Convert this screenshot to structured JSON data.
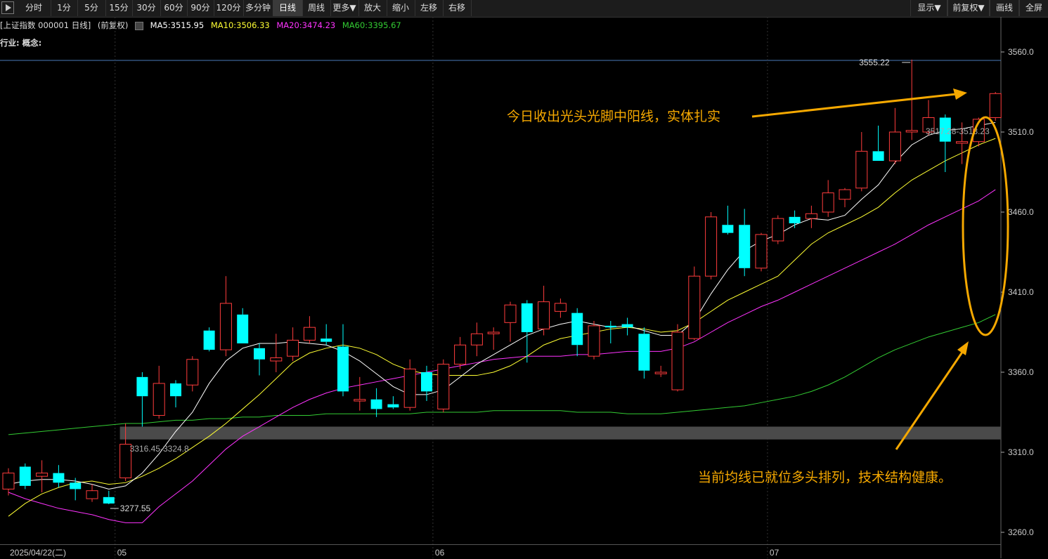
{
  "toolbar": {
    "items": [
      {
        "label": "分时"
      },
      {
        "label": "1分"
      },
      {
        "label": "5分"
      },
      {
        "label": "15分"
      },
      {
        "label": "30分"
      },
      {
        "label": "60分"
      },
      {
        "label": "90分"
      },
      {
        "label": "120分"
      },
      {
        "label": "多分钟"
      },
      {
        "label": "日线",
        "active": true
      },
      {
        "label": "周线"
      },
      {
        "label": "更多▼"
      },
      {
        "label": "放大"
      },
      {
        "label": "缩小"
      },
      {
        "label": "左移"
      },
      {
        "label": "右移"
      }
    ],
    "right_items": [
      {
        "label": "显示▼"
      },
      {
        "label": "前复权▼"
      },
      {
        "label": "画线"
      },
      {
        "label": "全屏"
      }
    ]
  },
  "info": {
    "title": "[上证指数 000001 日线]",
    "adjust": "(前复权)",
    "ma5": "MA5:3515.95",
    "ma10": "MA10:3506.33",
    "ma20": "MA20:3474.23",
    "ma60": "MA60:3395.67",
    "industry": "行业: 概念:"
  },
  "colors": {
    "up": "#ff3c3c",
    "down": "#00ffff",
    "ma5": "#ffffff",
    "ma10": "#ffff33",
    "ma20": "#ff33ff",
    "ma60": "#33cc33",
    "annotation": "#f5a800",
    "axis": "#cccccc"
  },
  "chart_data": {
    "type": "candlestick",
    "ylim": [
      3250,
      3570
    ],
    "y_ticks": [
      "3560.0",
      "3510.0",
      "3460.0",
      "3410.0",
      "3360.0",
      "3310.0",
      "3260.0"
    ],
    "x_labels": [
      {
        "label": "2025/04/22(二)",
        "index": 0
      },
      {
        "label": "05",
        "index": 7
      },
      {
        "label": "06",
        "index": 26
      },
      {
        "label": "07",
        "index": 46
      }
    ],
    "candles": [
      {
        "o": 3287,
        "h": 3300,
        "l": 3283,
        "c": 3297
      },
      {
        "o": 3301,
        "h": 3303,
        "l": 3287,
        "c": 3289
      },
      {
        "o": 3295,
        "h": 3305,
        "l": 3285,
        "c": 3297
      },
      {
        "o": 3297,
        "h": 3302,
        "l": 3288,
        "c": 3291
      },
      {
        "o": 3291,
        "h": 3294,
        "l": 3280,
        "c": 3287
      },
      {
        "o": 3281,
        "h": 3290,
        "l": 3279,
        "c": 3286
      },
      {
        "o": 3282,
        "h": 3286,
        "l": 3277.55,
        "c": 3278
      },
      {
        "o": 3294,
        "h": 3328,
        "l": 3292,
        "c": 3315
      },
      {
        "o": 3357,
        "h": 3360,
        "l": 3326,
        "c": 3345
      },
      {
        "o": 3333,
        "h": 3364,
        "l": 3331,
        "c": 3353
      },
      {
        "o": 3353,
        "h": 3355,
        "l": 3338,
        "c": 3345
      },
      {
        "o": 3352,
        "h": 3370,
        "l": 3348,
        "c": 3368
      },
      {
        "o": 3386,
        "h": 3388,
        "l": 3373,
        "c": 3374
      },
      {
        "o": 3374,
        "h": 3420,
        "l": 3370,
        "c": 3403
      },
      {
        "o": 3396,
        "h": 3400,
        "l": 3378,
        "c": 3378
      },
      {
        "o": 3375,
        "h": 3378,
        "l": 3358,
        "c": 3368
      },
      {
        "o": 3367,
        "h": 3384,
        "l": 3360,
        "c": 3369
      },
      {
        "o": 3370,
        "h": 3388,
        "l": 3367,
        "c": 3380
      },
      {
        "o": 3380,
        "h": 3395,
        "l": 3378,
        "c": 3388
      },
      {
        "o": 3381,
        "h": 3390,
        "l": 3377,
        "c": 3379
      },
      {
        "o": 3376,
        "h": 3390,
        "l": 3345,
        "c": 3348
      },
      {
        "o": 3342,
        "h": 3357,
        "l": 3336,
        "c": 3343
      },
      {
        "o": 3343,
        "h": 3350,
        "l": 3332,
        "c": 3337
      },
      {
        "o": 3340,
        "h": 3345,
        "l": 3337,
        "c": 3338
      },
      {
        "o": 3338,
        "h": 3368,
        "l": 3336,
        "c": 3362
      },
      {
        "o": 3360,
        "h": 3364,
        "l": 3342,
        "c": 3348
      },
      {
        "o": 3337,
        "h": 3368,
        "l": 3335,
        "c": 3365
      },
      {
        "o": 3365,
        "h": 3382,
        "l": 3362,
        "c": 3377
      },
      {
        "o": 3377,
        "h": 3391,
        "l": 3370,
        "c": 3384
      },
      {
        "o": 3384,
        "h": 3388,
        "l": 3374,
        "c": 3385
      },
      {
        "o": 3391,
        "h": 3404,
        "l": 3379,
        "c": 3402
      },
      {
        "o": 3403,
        "h": 3405,
        "l": 3366,
        "c": 3385
      },
      {
        "o": 3387,
        "h": 3414,
        "l": 3383,
        "c": 3404
      },
      {
        "o": 3398,
        "h": 3406,
        "l": 3394,
        "c": 3403
      },
      {
        "o": 3397,
        "h": 3400,
        "l": 3370,
        "c": 3377
      },
      {
        "o": 3370,
        "h": 3392,
        "l": 3368,
        "c": 3389
      },
      {
        "o": 3389,
        "h": 3392,
        "l": 3378,
        "c": 3388
      },
      {
        "o": 3390,
        "h": 3394,
        "l": 3383,
        "c": 3388
      },
      {
        "o": 3384,
        "h": 3388,
        "l": 3356,
        "c": 3361
      },
      {
        "o": 3359,
        "h": 3364,
        "l": 3357,
        "c": 3360
      },
      {
        "o": 3349,
        "h": 3390,
        "l": 3348,
        "c": 3385
      },
      {
        "o": 3381,
        "h": 3426,
        "l": 3380,
        "c": 3420
      },
      {
        "o": 3420,
        "h": 3460,
        "l": 3418,
        "c": 3457
      },
      {
        "o": 3452,
        "h": 3464,
        "l": 3446,
        "c": 3447
      },
      {
        "o": 3452,
        "h": 3462,
        "l": 3420,
        "c": 3425
      },
      {
        "o": 3425,
        "h": 3447,
        "l": 3423,
        "c": 3446
      },
      {
        "o": 3442,
        "h": 3458,
        "l": 3440,
        "c": 3456
      },
      {
        "o": 3457,
        "h": 3461,
        "l": 3450,
        "c": 3453
      },
      {
        "o": 3456,
        "h": 3464,
        "l": 3450,
        "c": 3459
      },
      {
        "o": 3460,
        "h": 3480,
        "l": 3457,
        "c": 3472
      },
      {
        "o": 3468,
        "h": 3475,
        "l": 3463,
        "c": 3474
      },
      {
        "o": 3475,
        "h": 3510,
        "l": 3473,
        "c": 3498
      },
      {
        "o": 3498,
        "h": 3514,
        "l": 3492,
        "c": 3492
      },
      {
        "o": 3492,
        "h": 3525,
        "l": 3490,
        "c": 3510
      },
      {
        "o": 3510,
        "h": 3555.22,
        "l": 3505,
        "c": 3511
      },
      {
        "o": 3510,
        "h": 3530,
        "l": 3508,
        "c": 3519
      },
      {
        "o": 3519,
        "h": 3521,
        "l": 3485,
        "c": 3504
      },
      {
        "o": 3503,
        "h": 3516,
        "l": 3490,
        "c": 3504
      },
      {
        "o": 3504,
        "h": 3519,
        "l": 3501,
        "c": 3518
      },
      {
        "o": 3519,
        "h": 3535,
        "l": 3517,
        "c": 3534
      }
    ],
    "ma5": [
      3290,
      3292,
      3293,
      3293,
      3292,
      3290,
      3287,
      3289,
      3297,
      3309,
      3323,
      3335,
      3353,
      3367,
      3375,
      3378,
      3378,
      3379,
      3378,
      3377,
      3373,
      3367,
      3359,
      3351,
      3346,
      3346,
      3349,
      3357,
      3365,
      3371,
      3377,
      3383,
      3387,
      3390,
      3392,
      3390,
      3388,
      3389,
      3386,
      3383,
      3383,
      3392,
      3409,
      3424,
      3436,
      3442,
      3446,
      3452,
      3456,
      3455,
      3458,
      3468,
      3477,
      3491,
      3502,
      3508,
      3511,
      3512,
      3514,
      3516
    ],
    "ma10": [
      3270,
      3278,
      3284,
      3288,
      3291,
      3292,
      3290,
      3291,
      3295,
      3300,
      3306,
      3313,
      3320,
      3328,
      3337,
      3346,
      3356,
      3366,
      3372,
      3375,
      3377,
      3375,
      3371,
      3365,
      3361,
      3359,
      3358,
      3358,
      3358,
      3360,
      3364,
      3370,
      3377,
      3381,
      3383,
      3385,
      3387,
      3388,
      3387,
      3385,
      3386,
      3391,
      3398,
      3405,
      3410,
      3415,
      3420,
      3430,
      3440,
      3447,
      3452,
      3457,
      3463,
      3472,
      3480,
      3486,
      3492,
      3497,
      3502,
      3506
    ],
    "ma20": [
      3285,
      3281,
      3278,
      3275,
      3273,
      3271,
      3268,
      3266,
      3266,
      3276,
      3284,
      3292,
      3302,
      3312,
      3320,
      3326,
      3332,
      3338,
      3343,
      3347,
      3350,
      3352,
      3354,
      3356,
      3358,
      3360,
      3362,
      3364,
      3366,
      3368,
      3369,
      3370,
      3370,
      3370,
      3371,
      3371,
      3372,
      3373,
      3373,
      3373,
      3375,
      3379,
      3385,
      3391,
      3396,
      3401,
      3405,
      3410,
      3415,
      3420,
      3425,
      3430,
      3435,
      3440,
      3446,
      3452,
      3457,
      3462,
      3467,
      3474
    ],
    "ma60": [
      3321,
      3322,
      3323,
      3324,
      3325,
      3326,
      3327,
      3328,
      3328,
      3329,
      3330,
      3330,
      3331,
      3331,
      3332,
      3332,
      3333,
      3333,
      3333,
      3334,
      3334,
      3334,
      3334,
      3334,
      3334,
      3335,
      3335,
      3335,
      3335,
      3336,
      3336,
      3336,
      3336,
      3336,
      3335,
      3335,
      3335,
      3334,
      3334,
      3334,
      3335,
      3336,
      3337,
      3338,
      3339,
      3341,
      3343,
      3345,
      3348,
      3352,
      3357,
      3363,
      3369,
      3374,
      3378,
      3382,
      3385,
      3388,
      3391,
      3396
    ],
    "band": [
      3318,
      3326
    ],
    "high_label": "3555.22",
    "low_label": "3277.55",
    "band_label": "3316.45-3324.8",
    "right_range_label": "3517.28-3518.23",
    "annotations": [
      {
        "text": "今日收出光头光脚中阳线，实体扎实"
      },
      {
        "text": "当前均线已就位多头排列，技术结构健康。"
      }
    ]
  }
}
